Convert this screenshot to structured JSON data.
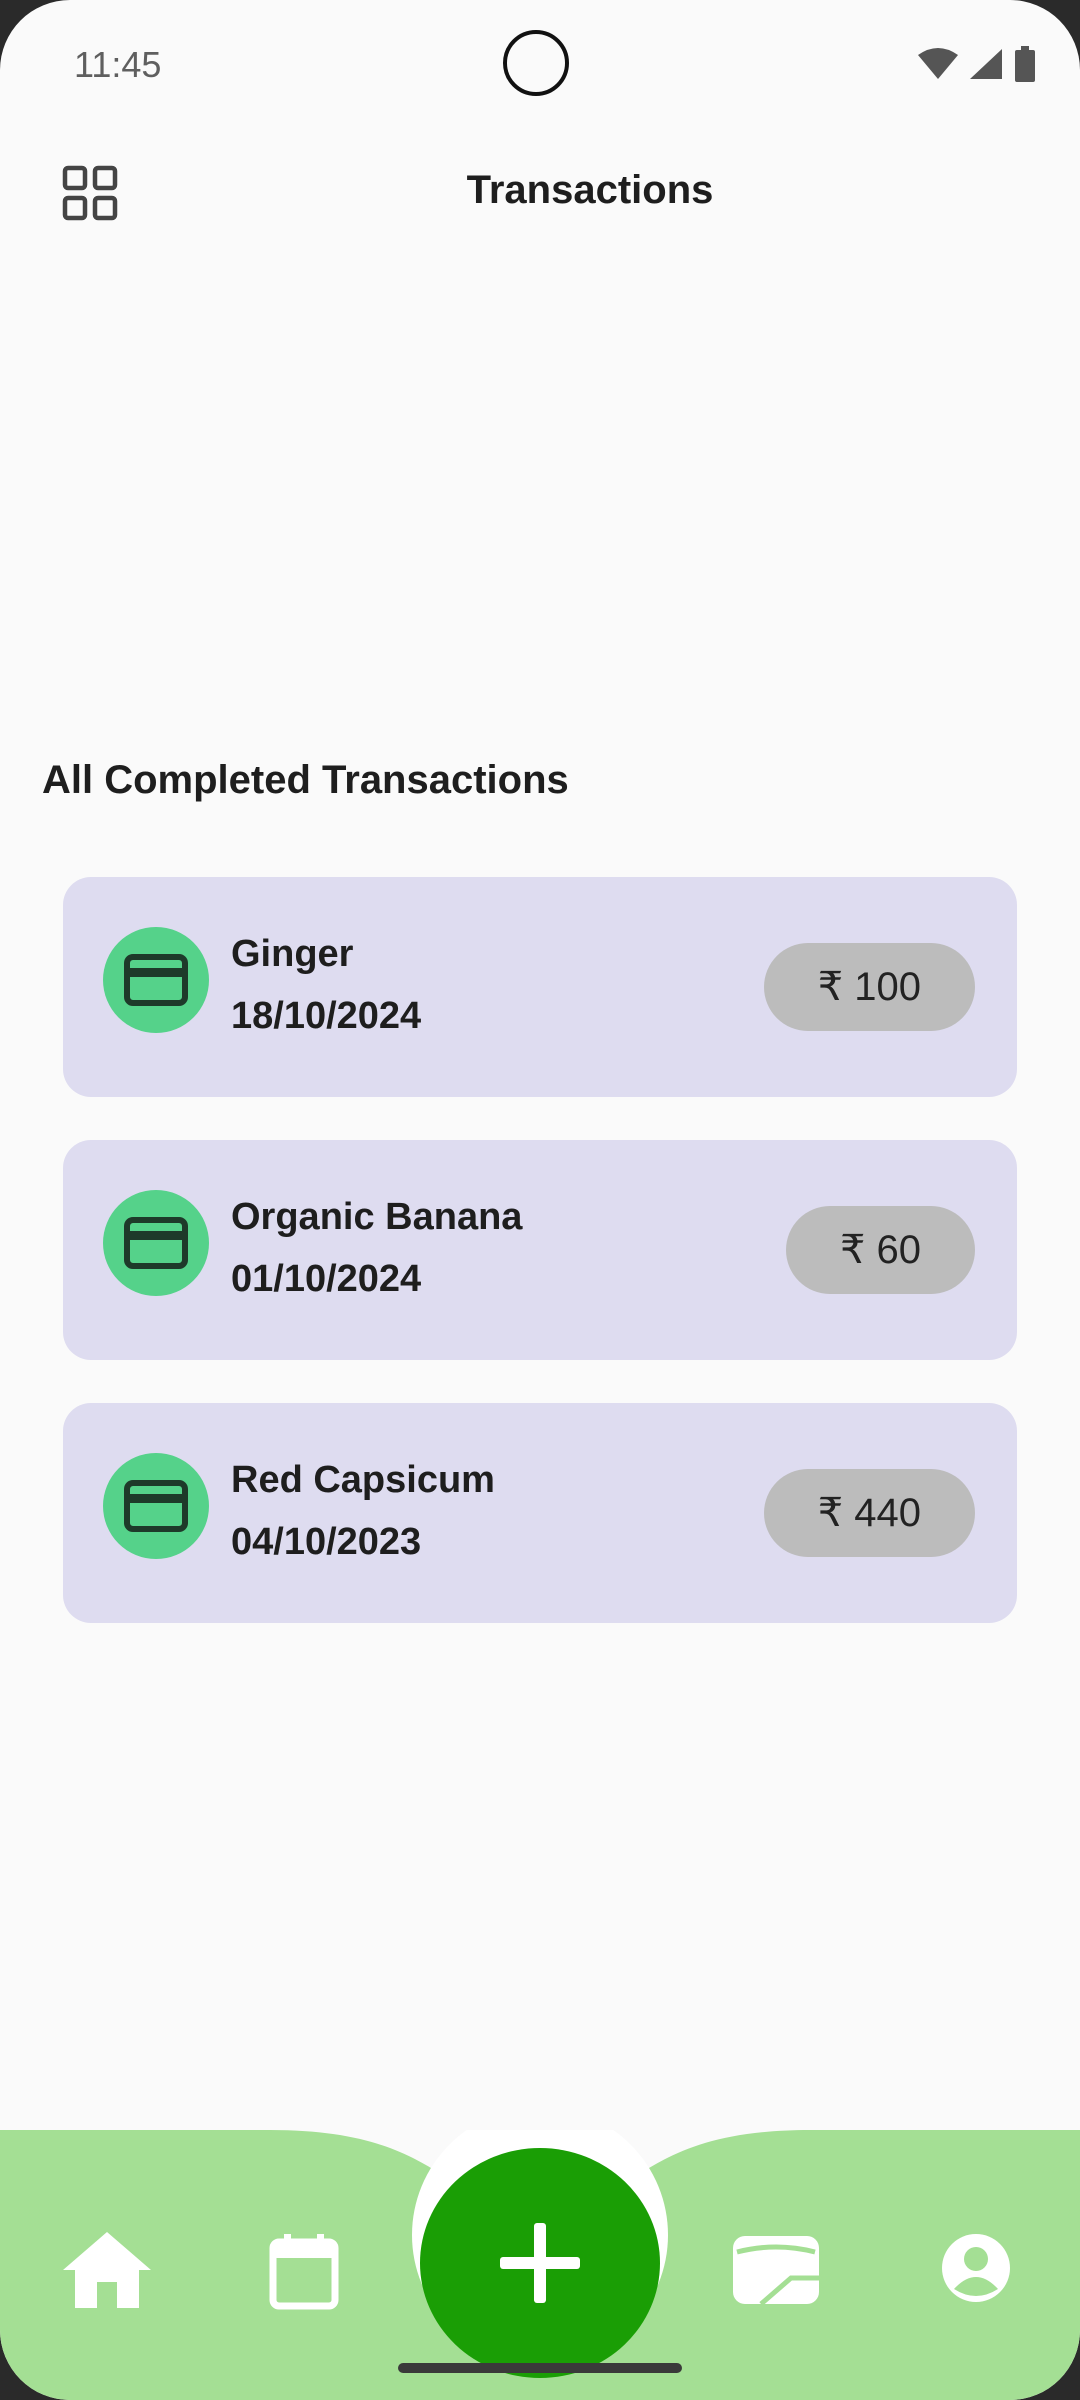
{
  "status": {
    "time": "11:45"
  },
  "header": {
    "title": "Transactions",
    "menu_icon": "grid-icon"
  },
  "section": {
    "title": "All Completed Transactions"
  },
  "transactions": [
    {
      "name": "Ginger",
      "date": "18/10/2024",
      "amount": "₹ 100",
      "icon": "credit-card-icon"
    },
    {
      "name": "Organic Banana",
      "date": "01/10/2024",
      "amount": "₹ 60",
      "icon": "credit-card-icon"
    },
    {
      "name": "Red Capsicum",
      "date": "04/10/2023",
      "amount": "₹ 440",
      "icon": "credit-card-icon"
    }
  ],
  "nav": {
    "items": [
      "home-icon",
      "calendar-icon",
      "add-icon",
      "wallet-icon",
      "profile-icon"
    ],
    "bg_color": "#a4df94",
    "fab_color": "#1a9e05"
  },
  "colors": {
    "card_bg": "#dedcf0",
    "icon_circle": "#55d28a",
    "amount_pill": "#bcbcbc"
  }
}
